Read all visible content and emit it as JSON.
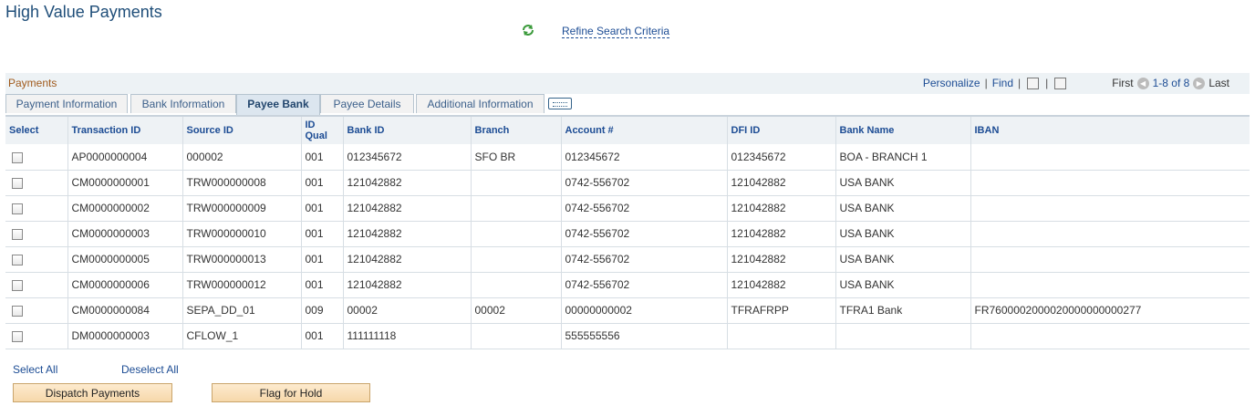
{
  "page": {
    "title": "High Value Payments",
    "refine_link": "Refine Search Criteria"
  },
  "grid": {
    "title": "Payments",
    "tools": {
      "personalize": "Personalize",
      "find": "Find",
      "first": "First",
      "range": "1-8 of 8",
      "last": "Last"
    },
    "tabs": [
      "Payment Information",
      "Bank Information",
      "Payee Bank",
      "Payee Details",
      "Additional Information"
    ],
    "active_tab": "Payee Bank",
    "columns": [
      "Select",
      "Transaction ID",
      "Source ID",
      "ID Qual",
      "Bank ID",
      "Branch",
      "Account #",
      "DFI ID",
      "Bank Name",
      "IBAN"
    ],
    "rows": [
      [
        "AP0000000004",
        "000002",
        "001",
        "012345672",
        "SFO BR",
        "012345672",
        "012345672",
        "BOA - BRANCH 1",
        ""
      ],
      [
        "CM0000000001",
        "TRW000000008",
        "001",
        "121042882",
        "",
        "0742-556702",
        "121042882",
        "USA BANK",
        ""
      ],
      [
        "CM0000000002",
        "TRW000000009",
        "001",
        "121042882",
        "",
        "0742-556702",
        "121042882",
        "USA BANK",
        ""
      ],
      [
        "CM0000000003",
        "TRW000000010",
        "001",
        "121042882",
        "",
        "0742-556702",
        "121042882",
        "USA BANK",
        ""
      ],
      [
        "CM0000000005",
        "TRW000000013",
        "001",
        "121042882",
        "",
        "0742-556702",
        "121042882",
        "USA BANK",
        ""
      ],
      [
        "CM0000000006",
        "TRW000000012",
        "001",
        "121042882",
        "",
        "0742-556702",
        "121042882",
        "USA BANK",
        ""
      ],
      [
        "CM0000000084",
        "SEPA_DD_01",
        "009",
        "00002",
        "00002",
        "00000000002",
        "TFRAFRPP",
        "TFRA1 Bank",
        "FR7600002000020000000000277"
      ],
      [
        "DM0000000003",
        "CFLOW_1",
        "001",
        "111111118",
        "",
        "555555556",
        "",
        "",
        ""
      ]
    ]
  },
  "actions": {
    "select_all": "Select All",
    "deselect_all": "Deselect All",
    "dispatch": "Dispatch Payments",
    "hold": "Flag for Hold"
  },
  "colors": {
    "link": "#1c4c94",
    "title": "#1f4e79",
    "grid_title": "#a05a1c",
    "button_bg": "#f6d8aa"
  }
}
